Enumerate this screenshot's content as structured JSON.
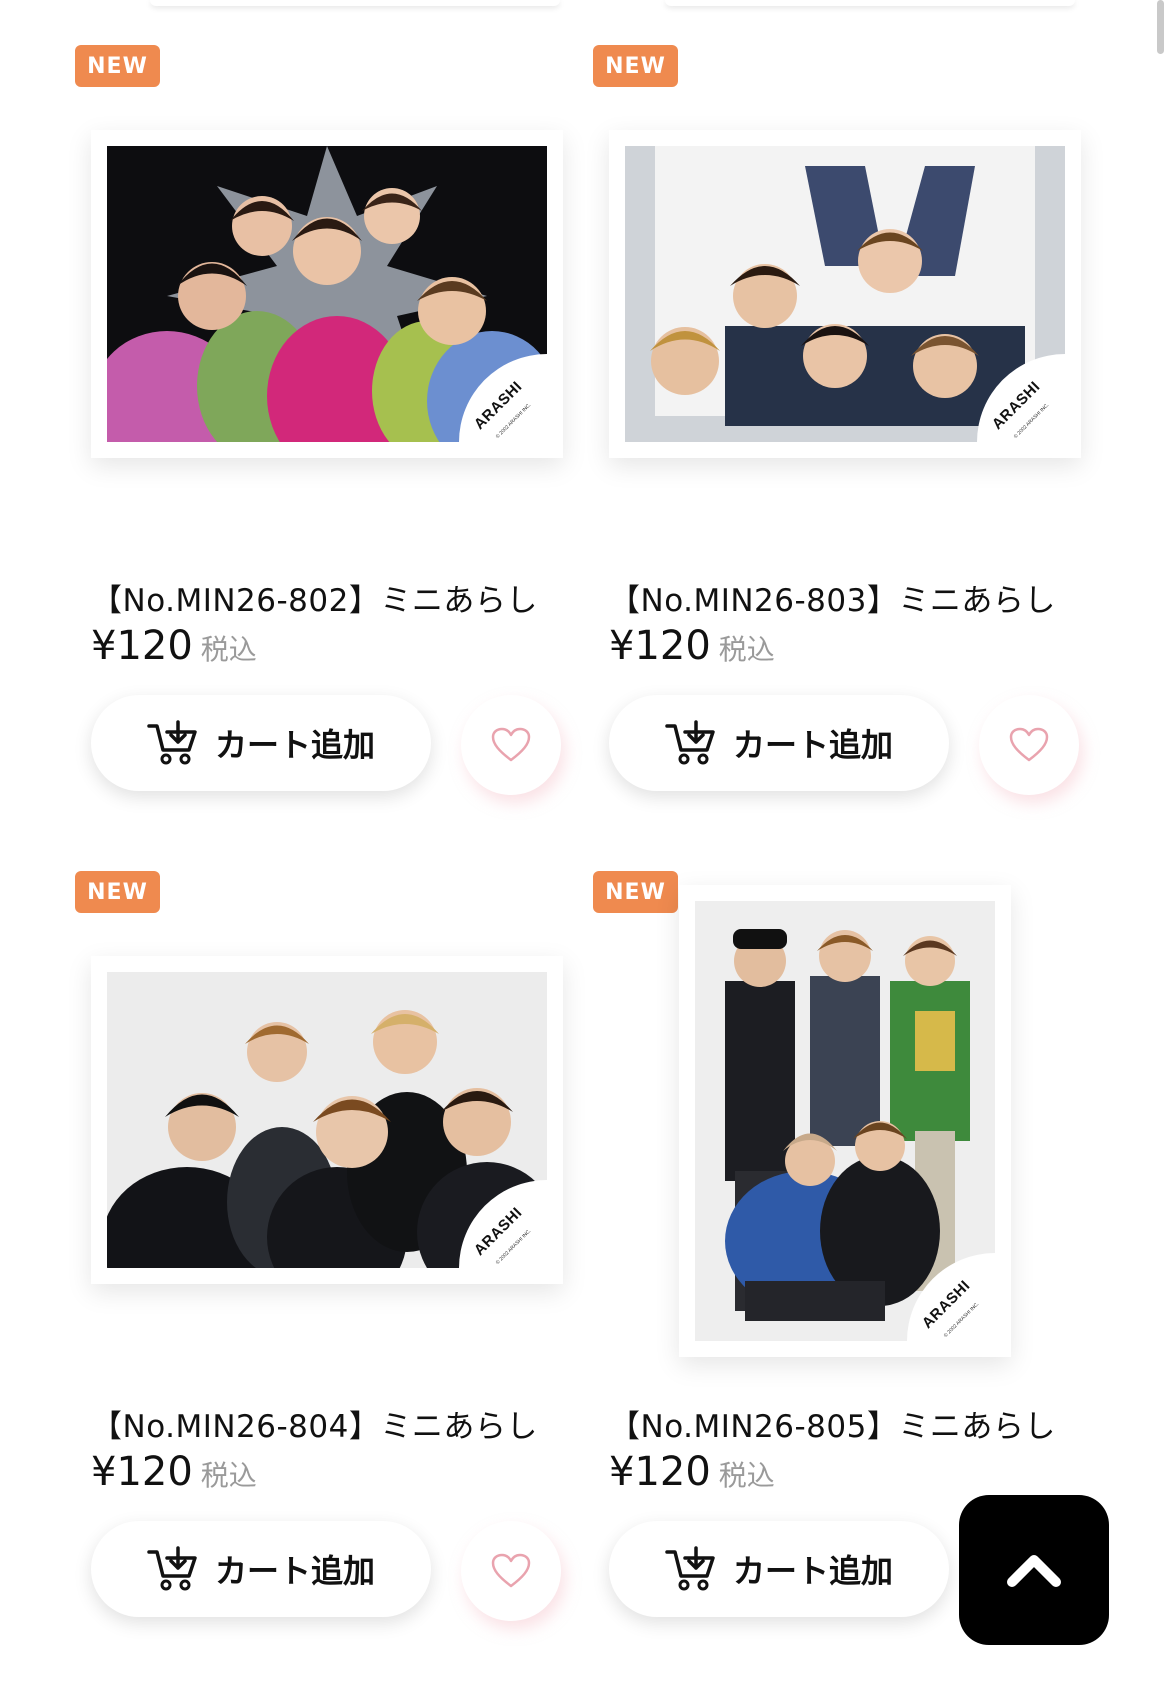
{
  "products": [
    {
      "badge": "NEW",
      "title": "【No.MIN26-802】ミニあらし",
      "price": "¥120",
      "tax": "税込",
      "cart_label": "カート追加",
      "stamp": "ARASHI",
      "stamp_copy": "© 2002 ARASHI INC."
    },
    {
      "badge": "NEW",
      "title": "【No.MIN26-803】ミニあらし",
      "price": "¥120",
      "tax": "税込",
      "cart_label": "カート追加",
      "stamp": "ARASHI",
      "stamp_copy": "© 2002 ARASHI INC."
    },
    {
      "badge": "NEW",
      "title": "【No.MIN26-804】ミニあらし",
      "price": "¥120",
      "tax": "税込",
      "cart_label": "カート追加",
      "stamp": "ARASHI",
      "stamp_copy": "© 2002 ARASHI INC."
    },
    {
      "badge": "NEW",
      "title": "【No.MIN26-805】ミニあらし",
      "price": "¥120",
      "tax": "税込",
      "cart_label": "カート追加",
      "stamp": "ARASHI",
      "stamp_copy": "© 2002 ARASHI INC."
    }
  ],
  "icons": {
    "cart": "cart-add-icon",
    "favorite": "heart-outline-icon",
    "scroll_top": "chevron-up-icon"
  },
  "colors": {
    "badge": "#ef8a4f",
    "heart": "#e9a3ae",
    "scroll_top_bg": "#000000"
  }
}
